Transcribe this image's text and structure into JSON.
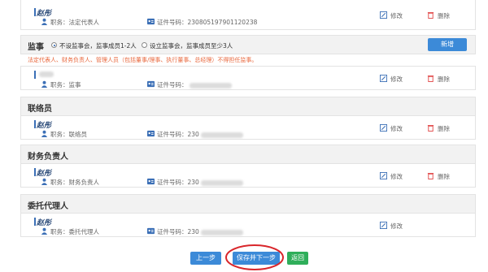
{
  "common": {
    "edit": "修改",
    "delete": "删除"
  },
  "legal": {
    "name": "赵彤",
    "position": "职务：法定代表人",
    "id_label": "证件号码：230805197901120238"
  },
  "supervisor": {
    "title": "监事",
    "option1": "不设监事会，监事成员1-2人",
    "option2": "设立监事会，监事成员至少3人",
    "add_button": "新增",
    "warning": "法定代表人、财务负责人、管理人员（包括董事/理事、执行董事、总经理）不得担任监事。",
    "position": "职务：监事",
    "id_label": "证件号码："
  },
  "liaison": {
    "title": "联络员",
    "name": "赵彤",
    "position": "职务：联络员",
    "id_label": "证件号码：230"
  },
  "finance": {
    "title": "财务负责人",
    "name": "赵彤",
    "position": "职务：财务负责人",
    "id_label": "证件号码：230"
  },
  "agent": {
    "title": "委托代理人",
    "name": "赵彤",
    "position": "职务：委托代理人",
    "id_label": "证件号码：230"
  },
  "footer": {
    "prev": "上一步",
    "save_next": "保存并下一步",
    "back": "返回"
  },
  "colors": {
    "primary_blue": "#3c8ad8",
    "green": "#2fae5a",
    "warning_red": "#e8663b",
    "highlight_ellipse": "#d9262b"
  }
}
